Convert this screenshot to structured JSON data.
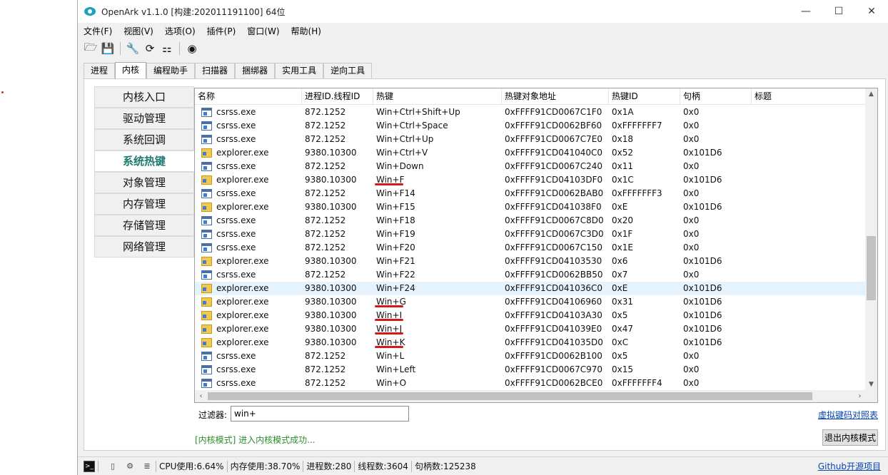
{
  "window": {
    "title": "OpenArk v1.1.0  [构建:202011191100]  64位",
    "controls": {
      "minimize": "—",
      "maximize": "☐",
      "close": "✕"
    }
  },
  "menu": [
    "文件(F)",
    "视图(V)",
    "选项(O)",
    "插件(P)",
    "窗口(W)",
    "帮助(H)"
  ],
  "toolbar": {
    "icons": [
      "folder-open-icon",
      "save-icon",
      "wrench-icon",
      "refresh-icon",
      "grid-icon",
      "github-icon"
    ],
    "glyphs": [
      "🗁",
      "💾",
      "🔧",
      "⟳",
      "⚏",
      "◉"
    ]
  },
  "tabs": [
    "进程",
    "内核",
    "编程助手",
    "扫描器",
    "捆绑器",
    "实用工具",
    "逆向工具"
  ],
  "active_tab": "内核",
  "sidebar": [
    "内核入口",
    "驱动管理",
    "系统回调",
    "系统热键",
    "对象管理",
    "内存管理",
    "存储管理",
    "网络管理"
  ],
  "active_sidebar": "系统热键",
  "table": {
    "sort_indicator": "⌃",
    "columns": [
      "名称",
      "进程ID.线程ID",
      "热键",
      "热键对象地址",
      "热键ID",
      "句柄",
      "标题"
    ],
    "rows": [
      {
        "icon": "csrss",
        "name": "csrss.exe",
        "pid": "872.1252",
        "hotkey": "Win+Ctrl+Shift+Up",
        "addr": "0xFFFF91CD0067C1F0",
        "id": "0x1A",
        "handle": "0x0"
      },
      {
        "icon": "csrss",
        "name": "csrss.exe",
        "pid": "872.1252",
        "hotkey": "Win+Ctrl+Space",
        "addr": "0xFFFF91CD0062BF60",
        "id": "0xFFFFFFF7",
        "handle": "0x0"
      },
      {
        "icon": "csrss",
        "name": "csrss.exe",
        "pid": "872.1252",
        "hotkey": "Win+Ctrl+Up",
        "addr": "0xFFFF91CD0067C7E0",
        "id": "0x18",
        "handle": "0x0"
      },
      {
        "icon": "explorer",
        "name": "explorer.exe",
        "pid": "9380.10300",
        "hotkey": "Win+Ctrl+V",
        "addr": "0xFFFF91CD041040C0",
        "id": "0x52",
        "handle": "0x101D6"
      },
      {
        "icon": "csrss",
        "name": "csrss.exe",
        "pid": "872.1252",
        "hotkey": "Win+Down",
        "addr": "0xFFFF91CD0067C240",
        "id": "0x11",
        "handle": "0x0"
      },
      {
        "icon": "explorer",
        "name": "explorer.exe",
        "pid": "9380.10300",
        "hotkey": "Win+F",
        "addr": "0xFFFF91CD04103DF0",
        "id": "0x1C",
        "handle": "0x101D6",
        "marked": true
      },
      {
        "icon": "csrss",
        "name": "csrss.exe",
        "pid": "872.1252",
        "hotkey": "Win+F14",
        "addr": "0xFFFF91CD0062BAB0",
        "id": "0xFFFFFFF3",
        "handle": "0x0"
      },
      {
        "icon": "explorer",
        "name": "explorer.exe",
        "pid": "9380.10300",
        "hotkey": "Win+F15",
        "addr": "0xFFFF91CD041038F0",
        "id": "0xE",
        "handle": "0x101D6"
      },
      {
        "icon": "csrss",
        "name": "csrss.exe",
        "pid": "872.1252",
        "hotkey": "Win+F18",
        "addr": "0xFFFF91CD0067C8D0",
        "id": "0x20",
        "handle": "0x0"
      },
      {
        "icon": "csrss",
        "name": "csrss.exe",
        "pid": "872.1252",
        "hotkey": "Win+F19",
        "addr": "0xFFFF91CD0067C3D0",
        "id": "0x1F",
        "handle": "0x0"
      },
      {
        "icon": "csrss",
        "name": "csrss.exe",
        "pid": "872.1252",
        "hotkey": "Win+F20",
        "addr": "0xFFFF91CD0067C150",
        "id": "0x1E",
        "handle": "0x0"
      },
      {
        "icon": "explorer",
        "name": "explorer.exe",
        "pid": "9380.10300",
        "hotkey": "Win+F21",
        "addr": "0xFFFF91CD04103530",
        "id": "0x6",
        "handle": "0x101D6"
      },
      {
        "icon": "csrss",
        "name": "csrss.exe",
        "pid": "872.1252",
        "hotkey": "Win+F22",
        "addr": "0xFFFF91CD0062BB50",
        "id": "0x7",
        "handle": "0x0"
      },
      {
        "icon": "explorer",
        "name": "explorer.exe",
        "pid": "9380.10300",
        "hotkey": "Win+F24",
        "addr": "0xFFFF91CD041036C0",
        "id": "0xE",
        "handle": "0x101D6",
        "selected": true
      },
      {
        "icon": "explorer",
        "name": "explorer.exe",
        "pid": "9380.10300",
        "hotkey": "Win+G",
        "addr": "0xFFFF91CD04106960",
        "id": "0x31",
        "handle": "0x101D6",
        "marked": true
      },
      {
        "icon": "explorer",
        "name": "explorer.exe",
        "pid": "9380.10300",
        "hotkey": "Win+I",
        "addr": "0xFFFF91CD04103A30",
        "id": "0x5",
        "handle": "0x101D6",
        "marked": true
      },
      {
        "icon": "explorer",
        "name": "explorer.exe",
        "pid": "9380.10300",
        "hotkey": "Win+J",
        "addr": "0xFFFF91CD041039E0",
        "id": "0x47",
        "handle": "0x101D6",
        "marked": true
      },
      {
        "icon": "explorer",
        "name": "explorer.exe",
        "pid": "9380.10300",
        "hotkey": "Win+K",
        "addr": "0xFFFF91CD041035D0",
        "id": "0xC",
        "handle": "0x101D6",
        "marked": true
      },
      {
        "icon": "csrss",
        "name": "csrss.exe",
        "pid": "872.1252",
        "hotkey": "Win+L",
        "addr": "0xFFFF91CD0062B100",
        "id": "0x5",
        "handle": "0x0"
      },
      {
        "icon": "csrss",
        "name": "csrss.exe",
        "pid": "872.1252",
        "hotkey": "Win+Left",
        "addr": "0xFFFF91CD0067C970",
        "id": "0x15",
        "handle": "0x0"
      },
      {
        "icon": "csrss",
        "name": "csrss.exe",
        "pid": "872.1252",
        "hotkey": "Win+O",
        "addr": "0xFFFF91CD0062BCE0",
        "id": "0xFFFFFFF4",
        "handle": "0x0"
      }
    ]
  },
  "filter": {
    "label": "过滤器:",
    "value": "win+"
  },
  "vk_link": "虚拟键码对照表",
  "status_message": "[内核模式] 进入内核模式成功...",
  "exit_button": "退出内核模式",
  "statusbar": {
    "cpu": "CPU使用:6.64%",
    "mem": "内存使用:38.70%",
    "procs": "进程数:280",
    "threads": "线程数:3604",
    "handles": "句柄数:125238",
    "github": "Github开源项目"
  },
  "colors": {
    "accent": "#1f7a6f",
    "link": "#0645ad",
    "status_ok": "#2e8b2e",
    "annotation": "#d11a1a"
  }
}
